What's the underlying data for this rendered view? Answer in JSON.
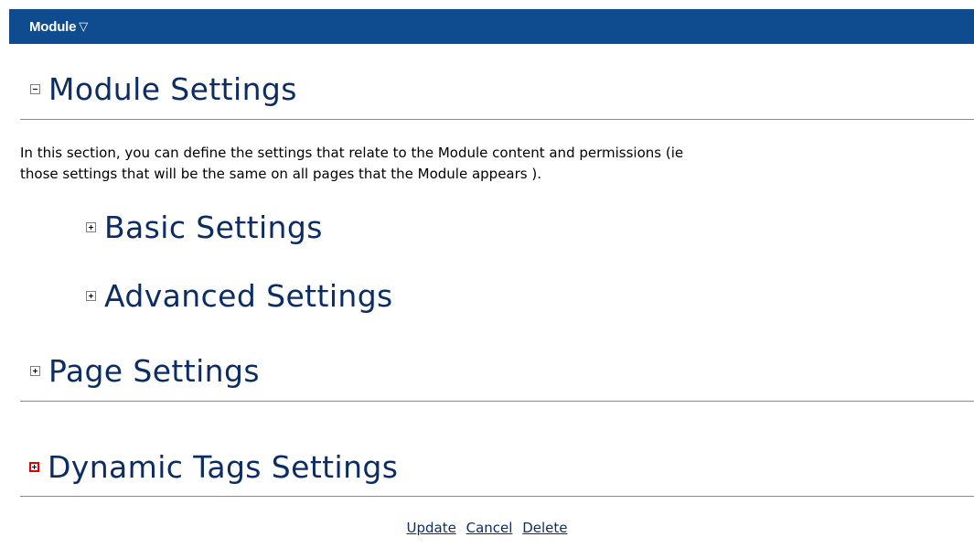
{
  "header": {
    "title": "Module",
    "caret_icon": "triangle-down-icon",
    "background": "#0f4b8f"
  },
  "sections": {
    "module": {
      "title": "Module Settings",
      "state": "expanded",
      "description_line1": "In this section, you can define the settings that relate to the Module content and permissions (ie",
      "description_line2": "those settings that will be the same on all pages that the Module appears ).",
      "subsections": {
        "basic": {
          "title": "Basic Settings",
          "state": "collapsed"
        },
        "advanced": {
          "title": "Advanced Settings",
          "state": "collapsed"
        }
      }
    },
    "page": {
      "title": "Page Settings",
      "state": "collapsed"
    },
    "dynamic_tags": {
      "title": "Dynamic Tags Settings",
      "state": "collapsed",
      "highlight_color": "#e00000"
    }
  },
  "actions": {
    "update": "Update",
    "cancel": "Cancel",
    "delete": "Delete"
  },
  "colors": {
    "title_text": "#0c2d63",
    "link": "#0c2d63",
    "rule": "#8a8a8a"
  }
}
